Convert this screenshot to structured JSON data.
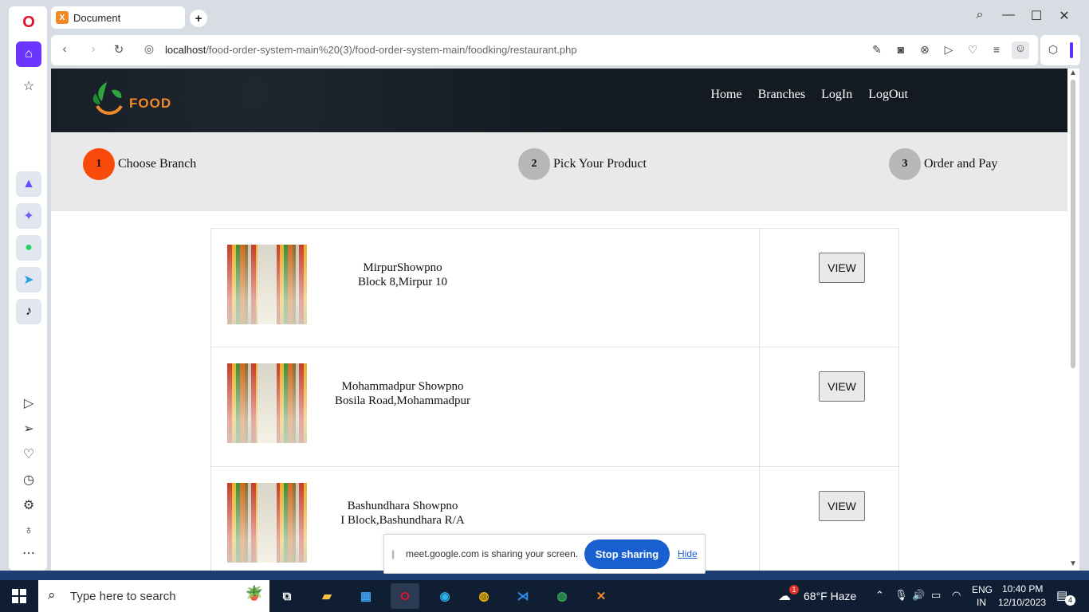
{
  "browser": {
    "tab_title": "Document",
    "url_host": "localhost",
    "url_path": "/food-order-system-main%20(3)/food-order-system-main/foodking/restaurant.php"
  },
  "site": {
    "logo_text": "FOOD",
    "nav": [
      "Home",
      "Branches",
      "LogIn",
      "LogOut"
    ],
    "steps": [
      {
        "num": "1",
        "label": "Choose Branch",
        "active": true
      },
      {
        "num": "2",
        "label": "Pick Your Product",
        "active": false
      },
      {
        "num": "3",
        "label": "Order and Pay",
        "active": false
      }
    ],
    "branches": [
      {
        "name": "MirpurShowpno",
        "address": "Block 8,Mirpur 10",
        "button": "VIEW"
      },
      {
        "name": "Mohammadpur Showpno",
        "address": "Bosila Road,Mohammadpur",
        "button": "VIEW"
      },
      {
        "name": "Bashundhara Showpno",
        "address": "I Block,Bashundhara R/A",
        "button": "VIEW"
      }
    ]
  },
  "share_bar": {
    "message": "meet.google.com is sharing your screen.",
    "stop_label": "Stop sharing",
    "hide_label": "Hide"
  },
  "taskbar": {
    "search_placeholder": "Type here to search",
    "weather": "68°F  Haze",
    "lang_top": "ENG",
    "lang_bottom": "IN",
    "time": "10:40 PM",
    "date": "12/10/2023",
    "notification_count": "4",
    "weather_badge": "1"
  },
  "colors": {
    "accent_step": "#f84a0a",
    "header_bg": "#141a22",
    "logo_orange": "#f08a24",
    "stop_sharing_blue": "#1a5fd0"
  }
}
